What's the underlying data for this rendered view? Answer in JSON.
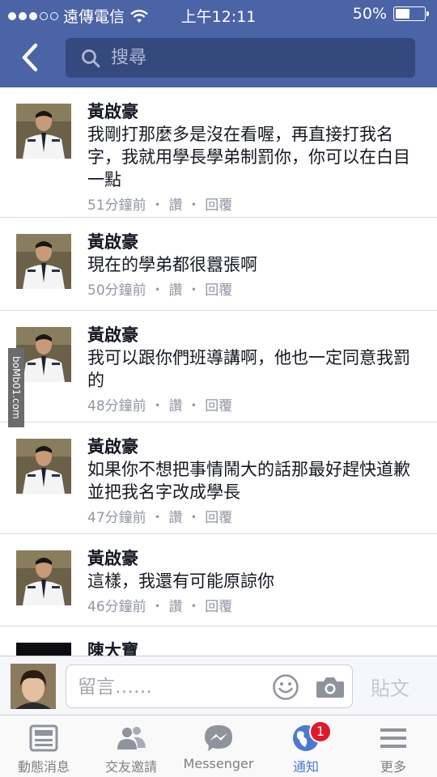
{
  "status_bar": {
    "carrier": "遠傳電信",
    "time": "上午12:11",
    "battery": "50%",
    "battery_level": 0.5,
    "signal_bars": 3
  },
  "header": {
    "search_placeholder": "搜尋"
  },
  "comments": [
    {
      "name": "黃啟豪",
      "body": "我剛打那麼多是沒在看喔，再直接打我名字，我就用學長學弟制罰你，你可以在白目一點",
      "time": "51分鐘前",
      "like": "讚",
      "reply": "回覆",
      "sep": "・"
    },
    {
      "name": "黃啟豪",
      "body": "現在的學弟都很囂張啊",
      "time": "50分鐘前",
      "like": "讚",
      "reply": "回覆",
      "sep": "・"
    },
    {
      "name": "黃啟豪",
      "body": "我可以跟你們班導講啊，他也一定同意我罰的",
      "time": "48分鐘前",
      "like": "讚",
      "reply": "回覆",
      "sep": "・"
    },
    {
      "name": "黃啟豪",
      "body": "如果你不想把事情鬧大的話那最好趕快道歉並把我名字改成學長",
      "time": "47分鐘前",
      "like": "讚",
      "reply": "回覆",
      "sep": "・"
    },
    {
      "name": "黃啟豪",
      "body": "這樣，我還有可能原諒你",
      "time": "46分鐘前",
      "like": "讚",
      "reply": "回覆",
      "sep": "・"
    },
    {
      "name": "陳大寶",
      "body": "",
      "time": "",
      "like": "",
      "reply": "",
      "sep": ""
    }
  ],
  "watermark": "boMb01.com",
  "composer": {
    "placeholder": "留言……",
    "post_label": "貼文"
  },
  "tabs": [
    {
      "label": "動態消息",
      "icon": "news-feed-icon"
    },
    {
      "label": "交友邀請",
      "icon": "friend-requests-icon"
    },
    {
      "label": "Messenger",
      "icon": "messenger-icon"
    },
    {
      "label": "通知",
      "icon": "notifications-globe-icon",
      "badge": "1",
      "active": true
    },
    {
      "label": "更多",
      "icon": "menu-icon"
    }
  ],
  "colors": {
    "header_blue": "#4a64a6",
    "active_tab": "#4a7bd0",
    "badge_red": "#e0192a"
  }
}
